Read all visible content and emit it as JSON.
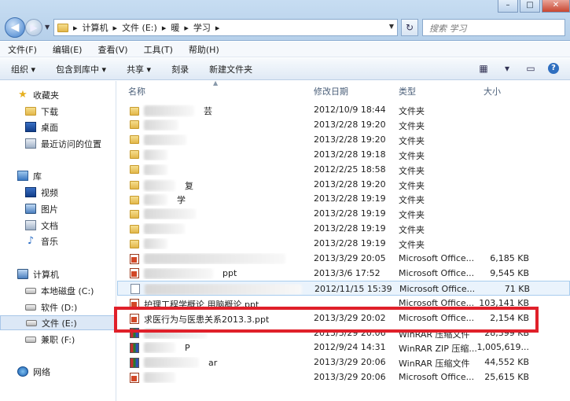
{
  "window": {
    "min": "–",
    "max": "□",
    "close": "✕"
  },
  "address": {
    "crumbs": [
      "计算机",
      "文件 (E:)",
      "暖",
      "学习"
    ],
    "sep": "▸",
    "search_placeholder": "搜索 学习"
  },
  "menu": [
    "文件(F)",
    "编辑(E)",
    "查看(V)",
    "工具(T)",
    "帮助(H)"
  ],
  "toolbar": [
    "组织 ▾",
    "包含到库中 ▾",
    "共享 ▾",
    "刻录",
    "新建文件夹"
  ],
  "nav": {
    "favorites": "收藏夹",
    "downloads": "下载",
    "desktop": "桌面",
    "recent": "最近访问的位置",
    "libraries": "库",
    "videos": "视频",
    "pictures": "图片",
    "documents": "文档",
    "music": "音乐",
    "computer": "计算机",
    "drive_c": "本地磁盘 (C:)",
    "drive_d": "软件 (D:)",
    "drive_e": "文件 (E:)",
    "drive_f": "兼职 (F:)",
    "network": "网络"
  },
  "columns": {
    "name": "名称",
    "date": "修改日期",
    "type": "类型",
    "size": "大小"
  },
  "files": [
    {
      "icon": "folder",
      "name": "",
      "tail": "芸",
      "date": "2012/10/9 18:44",
      "type": "文件夹",
      "size": ""
    },
    {
      "icon": "folder",
      "name": "",
      "tail": "",
      "date": "2013/2/28 19:20",
      "type": "文件夹",
      "size": ""
    },
    {
      "icon": "folder",
      "name": "",
      "tail": "",
      "date": "2013/2/28 19:20",
      "type": "文件夹",
      "size": ""
    },
    {
      "icon": "folder",
      "name": "",
      "tail": "",
      "date": "2013/2/28 19:18",
      "type": "文件夹",
      "size": ""
    },
    {
      "icon": "folder",
      "name": "",
      "tail": "",
      "date": "2012/2/25 18:58",
      "type": "文件夹",
      "size": ""
    },
    {
      "icon": "folder",
      "name": "",
      "tail": "复",
      "date": "2013/2/28 19:20",
      "type": "文件夹",
      "size": ""
    },
    {
      "icon": "folder",
      "name": "",
      "tail": "学",
      "date": "2013/2/28 19:19",
      "type": "文件夹",
      "size": ""
    },
    {
      "icon": "folder",
      "name": "",
      "tail": "",
      "date": "2013/2/28 19:19",
      "type": "文件夹",
      "size": ""
    },
    {
      "icon": "folder",
      "name": "",
      "tail": "",
      "date": "2013/2/28 19:19",
      "type": "文件夹",
      "size": ""
    },
    {
      "icon": "folder",
      "name": "",
      "tail": "",
      "date": "2013/2/28 19:19",
      "type": "文件夹",
      "size": ""
    },
    {
      "icon": "ppt",
      "name": "",
      "tail": "",
      "date": "2013/3/29 20:05",
      "type": "Microsoft Office...",
      "size": "6,185 KB"
    },
    {
      "icon": "ppt",
      "name": "",
      "tail": "ppt",
      "date": "2013/3/6 17:52",
      "type": "Microsoft Office...",
      "size": "9,545 KB"
    },
    {
      "icon": "doc",
      "name": "",
      "tail": "",
      "date": "2012/11/15 15:39",
      "type": "Microsoft Office...",
      "size": "71 KB"
    },
    {
      "icon": "ppt",
      "name": "护理工程学概论 用脑概论.ppt",
      "tail": "",
      "date": "",
      "type": "Microsoft Office...",
      "size": "103,141 KB"
    },
    {
      "icon": "ppt",
      "name": "求医行为与医患关系2013.3.ppt",
      "tail": "",
      "date": "2013/3/29 20:02",
      "type": "Microsoft Office...",
      "size": "2,154 KB"
    },
    {
      "icon": "zip",
      "name": "",
      "tail": "",
      "date": "2013/3/29 20:06",
      "type": "WinRAR 压缩文件",
      "size": "28,399 KB"
    },
    {
      "icon": "zip",
      "name": "",
      "tail": "P",
      "date": "2012/9/24 14:31",
      "type": "WinRAR ZIP 压缩...",
      "size": "1,005,619..."
    },
    {
      "icon": "zip",
      "name": "",
      "tail": "ar",
      "date": "2013/3/29 20:06",
      "type": "WinRAR 压缩文件",
      "size": "44,552 KB"
    },
    {
      "icon": "ppt",
      "name": "",
      "tail": "",
      "date": "2013/3/29 20:06",
      "type": "Microsoft Office...",
      "size": "25,615 KB"
    }
  ]
}
